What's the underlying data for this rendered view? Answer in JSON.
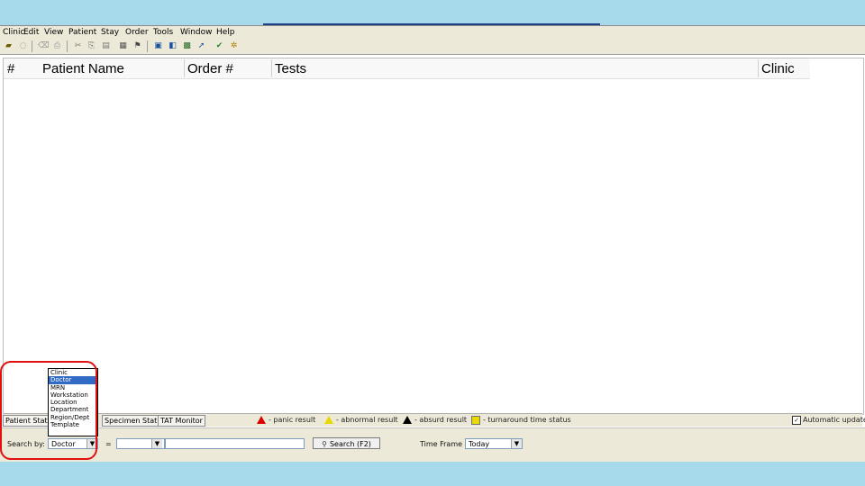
{
  "menu": [
    "Clinic",
    "Edit",
    "View",
    "Patient",
    "Stay",
    "Order",
    "Tools",
    "Window",
    "Help"
  ],
  "columns": [
    "#",
    "Patient Name",
    "Order #",
    "Tests",
    "Clinic"
  ],
  "tabs": [
    "Patient Status",
    "Specimen Status",
    "TAT Monitor"
  ],
  "legend": {
    "panic": "- panic result",
    "abnormal": "- abnormal result",
    "absurd": "- absurd result",
    "tat": "- turnaround time status",
    "auto_update": "Automatic update"
  },
  "search": {
    "label": "Search by:",
    "by_value": "Doctor",
    "equals": "=",
    "value": "",
    "button": "Search (F2)",
    "timeframe_label": "Time Frame",
    "timeframe_value": "Today"
  },
  "dropdown_options": [
    "Clinic",
    "Doctor",
    "MRN",
    "Workstation",
    "Location",
    "Department",
    "Region/Dept",
    "Template"
  ],
  "dropdown_selected": "Doctor",
  "colors": {
    "callout": "#e01010",
    "selection": "#316ac5",
    "chrome": "#ece9d8"
  }
}
